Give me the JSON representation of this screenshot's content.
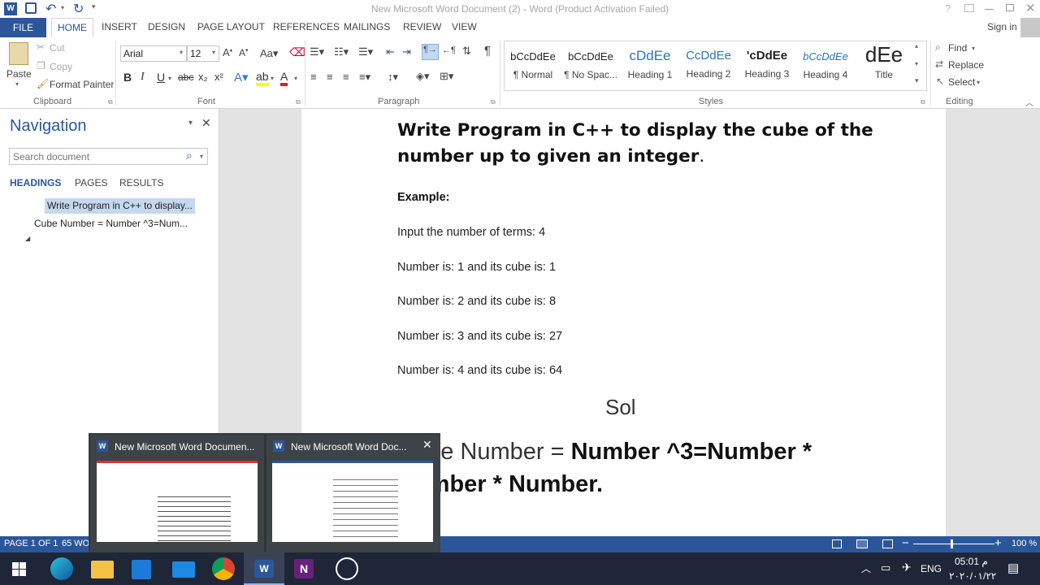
{
  "window": {
    "title": "New Microsoft Word Document (2) - Word (Product Activation Failed)",
    "help": "?"
  },
  "ribbon_tabs": {
    "file": "FILE",
    "home": "HOME",
    "insert": "INSERT",
    "design": "DESIGN",
    "page_layout": "PAGE LAYOUT",
    "references": "REFERENCES",
    "mailings": "MAILINGS",
    "review": "REVIEW",
    "view": "VIEW",
    "sign_in": "Sign in"
  },
  "clipboard": {
    "paste": "Paste",
    "cut": "Cut",
    "copy": "Copy",
    "format_painter": "Format Painter",
    "label": "Clipboard"
  },
  "font": {
    "name": "Arial",
    "size": "12",
    "label": "Font",
    "bold": "B",
    "italic": "I",
    "underline": "U",
    "strike": "abc",
    "sub": "x₂",
    "sup": "x²"
  },
  "paragraph": {
    "label": "Paragraph"
  },
  "styles": {
    "label": "Styles",
    "items": [
      {
        "sample": "bCcDdEe",
        "name": "¶ Normal"
      },
      {
        "sample": "bCcDdEe",
        "name": "¶ No Spac..."
      },
      {
        "sample": "cDdEe",
        "name": "Heading 1"
      },
      {
        "sample": "CcDdEe",
        "name": "Heading 2"
      },
      {
        "sample": "'cDdEe",
        "name": "Heading 3"
      },
      {
        "sample": "bCcDdEe",
        "name": "Heading 4"
      },
      {
        "sample": "dEe",
        "name": "Title"
      }
    ]
  },
  "editing": {
    "find": "Find",
    "replace": "Replace",
    "select": "Select",
    "label": "Editing"
  },
  "navigation": {
    "title": "Navigation",
    "search_placeholder": "Search document",
    "tabs": [
      "HEADINGS",
      "PAGES",
      "RESULTS"
    ],
    "headings": [
      "Write Program in C++ to display...",
      "Cube Number = Number ^3=Num..."
    ]
  },
  "document": {
    "heading": "Write Program in C++ to display the cube of the number up to given an integer.",
    "heading_line1": "Write Program in C++ to display the cube of the",
    "heading_line2": "number up to given an integer",
    "heading_period": ".",
    "example": "Example:",
    "lines": [
      "Input the number of terms: 4",
      "Number is: 1 and its cube is: 1",
      "Number is: 2 and its cube is: 8",
      "Number is: 3 and its cube is: 27",
      "Number is: 4 and its cube is: 64"
    ],
    "sol": "Sol",
    "formula_start": "Cube Number = ",
    "formula_bold": "Number ^3=Number *",
    "formula_line2": "Number * Number."
  },
  "status": {
    "page": "PAGE 1 OF 1",
    "words": "65 WO",
    "zoom": "100 %"
  },
  "taskbar_preview": {
    "items": [
      {
        "title": "New Microsoft Word Documen..."
      },
      {
        "title": "New Microsoft Word Doc..."
      }
    ]
  },
  "tray": {
    "lang": "ENG",
    "time": "05:01 م",
    "date": "٢٠٢٠/٠١/٢٢"
  },
  "colors": {
    "word_blue": "#2b579a",
    "taskbar": "#1e2637"
  }
}
